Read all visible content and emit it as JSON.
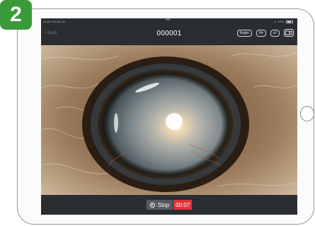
{
  "step": {
    "number": "2",
    "color": "#3a9a3a"
  },
  "statusbar": {
    "time_date": "14:52  Thu Jun 22",
    "center_dots": "•••",
    "battery": "67%"
  },
  "nav": {
    "back_label": "< Back",
    "title": "000001",
    "buttons": [
      {
        "label": "Bright",
        "icon": ""
      },
      {
        "label": "FA",
        "icon": ""
      },
      {
        "label": "x2",
        "icon": ""
      }
    ],
    "record_icon": "video-camera-icon"
  },
  "video": {
    "content": "close-up-eye-with-cataract"
  },
  "controls": {
    "stop_label": "Stop",
    "timer": "00:07",
    "timer_color": "#e2323a"
  }
}
